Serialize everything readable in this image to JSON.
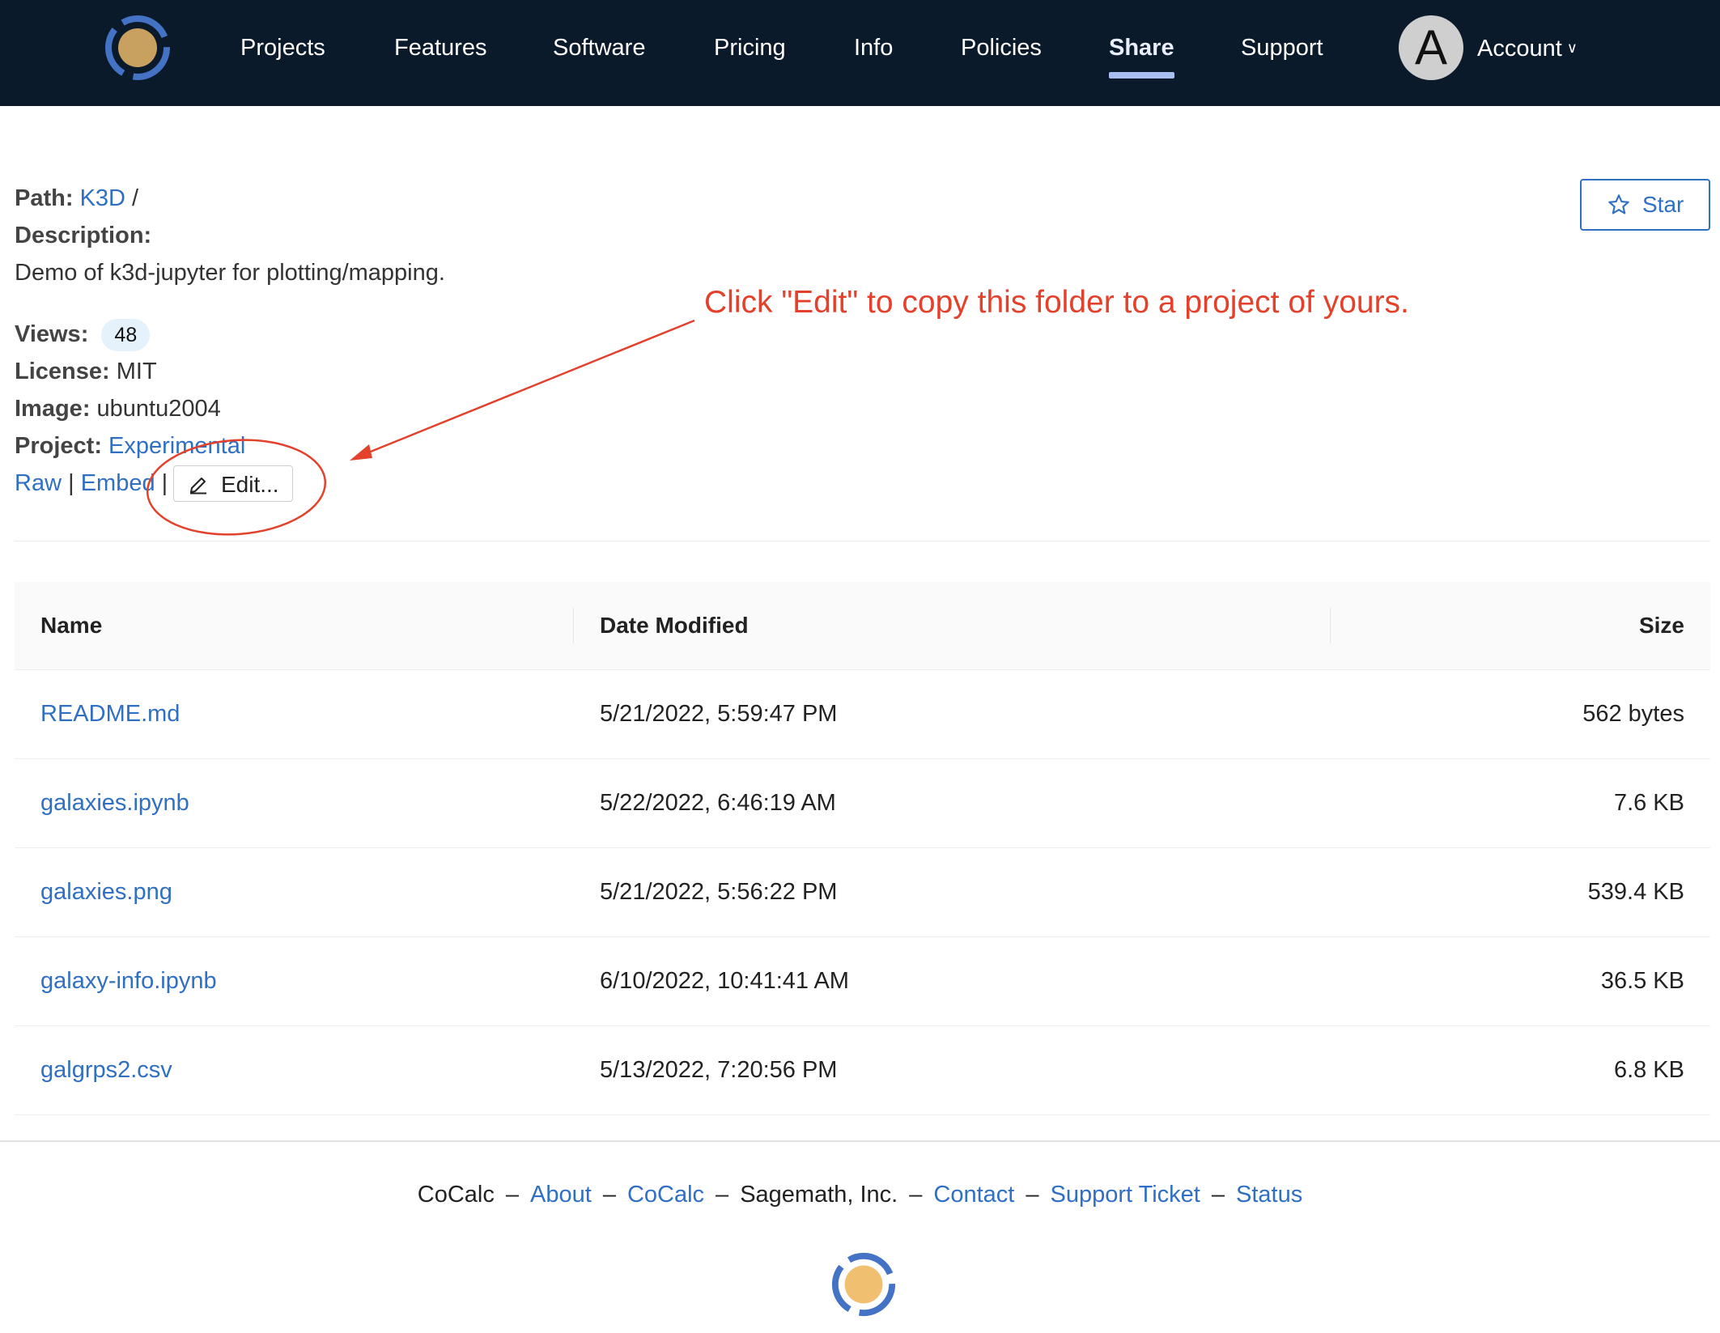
{
  "nav": {
    "items": [
      "Projects",
      "Features",
      "Software",
      "Pricing",
      "Info",
      "Policies",
      "Share",
      "Support"
    ],
    "active": "Share",
    "avatar_letter": "A",
    "account_label": "Account"
  },
  "meta": {
    "path_label": "Path:",
    "path_link": "K3D",
    "path_sep": "/",
    "description_label": "Description:",
    "description": "Demo of k3d-jupyter for plotting/mapping.",
    "views_label": "Views:",
    "views": "48",
    "license_label": "License:",
    "license": "MIT",
    "image_label": "Image:",
    "image": "ubuntu2004",
    "project_label": "Project:",
    "project": "Experimental",
    "raw": "Raw",
    "embed": "Embed",
    "pipe": "|",
    "edit": "Edit..."
  },
  "star_label": "Star",
  "annotation": "Click \"Edit\" to copy this folder to a project of yours.",
  "table": {
    "headers": {
      "name": "Name",
      "date": "Date Modified",
      "size": "Size"
    },
    "rows": [
      {
        "name": "README.md",
        "date": "5/21/2022, 5:59:47 PM",
        "size": "562 bytes"
      },
      {
        "name": "galaxies.ipynb",
        "date": "5/22/2022, 6:46:19 AM",
        "size": "7.6 KB"
      },
      {
        "name": "galaxies.png",
        "date": "5/21/2022, 5:56:22 PM",
        "size": "539.4 KB"
      },
      {
        "name": "galaxy-info.ipynb",
        "date": "6/10/2022, 10:41:41 AM",
        "size": "36.5 KB"
      },
      {
        "name": "galgrps2.csv",
        "date": "5/13/2022, 7:20:56 PM",
        "size": "6.8 KB"
      }
    ]
  },
  "footer": {
    "brand": "CoCalc",
    "about": "About",
    "cocalc": "CoCalc",
    "company": "Sagemath, Inc.",
    "contact": "Contact",
    "support_ticket": "Support Ticket",
    "status": "Status",
    "dash": "–"
  },
  "colors": {
    "nav_bg": "#0b1a2b",
    "link": "#2f6fc4",
    "annotation": "#e3412b",
    "logo_ring": "#4472c4",
    "logo_core": "#c8a060"
  }
}
